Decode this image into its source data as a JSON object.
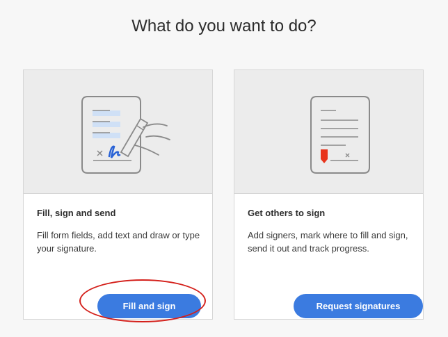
{
  "page": {
    "heading": "What do you want to do?"
  },
  "cards": [
    {
      "title": "Fill, sign and send",
      "description": "Fill form fields, add text and draw or type your signature.",
      "button_label": "Fill and sign",
      "illustration_icon": "fill-sign-document-icon"
    },
    {
      "title": "Get others to sign",
      "description": "Add signers, mark where to fill and sign, send it out and track progress.",
      "button_label": "Request signatures",
      "illustration_icon": "request-signatures-document-icon"
    }
  ],
  "colors": {
    "primary_button": "#3b7be0",
    "highlight_annotation": "#d4201b",
    "illustration_accent_blue": "#2a63d6",
    "illustration_accent_red": "#e8341c",
    "illustration_light_blue": "#cfe0f6"
  }
}
